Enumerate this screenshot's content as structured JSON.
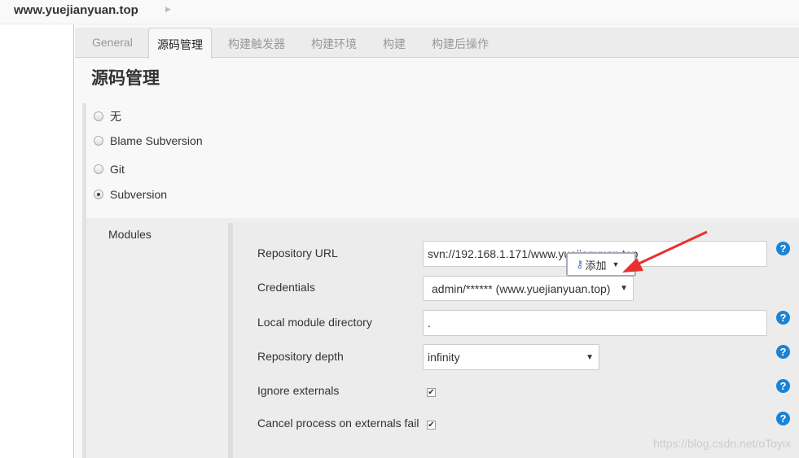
{
  "breadcrumb": {
    "site": "www.yuejianyuan.top"
  },
  "tabs": [
    "General",
    "源码管理",
    "构建触发器",
    "构建环境",
    "构建",
    "构建后操作"
  ],
  "active_tab": 1,
  "page_title": "源码管理",
  "scm_options": [
    {
      "label": "无",
      "selected": false
    },
    {
      "label": "Blame Subversion",
      "selected": false
    },
    {
      "label": "Git",
      "selected": false
    },
    {
      "label": "Subversion",
      "selected": true
    }
  ],
  "modules": {
    "label": "Modules",
    "repository_url": {
      "label": "Repository URL",
      "value": "svn://192.168.1.171/www.yuejianyuan.top"
    },
    "credentials": {
      "label": "Credentials",
      "value": "admin/****** (www.yuejianyuan.top)",
      "add_label": "添加"
    },
    "local_dir": {
      "label": "Local module directory",
      "value": "."
    },
    "depth": {
      "label": "Repository depth",
      "value": "infinity"
    },
    "ignore_externals": {
      "label": "Ignore externals",
      "checked": true
    },
    "cancel_process": {
      "label": "Cancel process on externals fail",
      "checked": true
    }
  },
  "annotation_color": "#e8312f",
  "watermark": "https://blog.csdn.net/oToyix"
}
